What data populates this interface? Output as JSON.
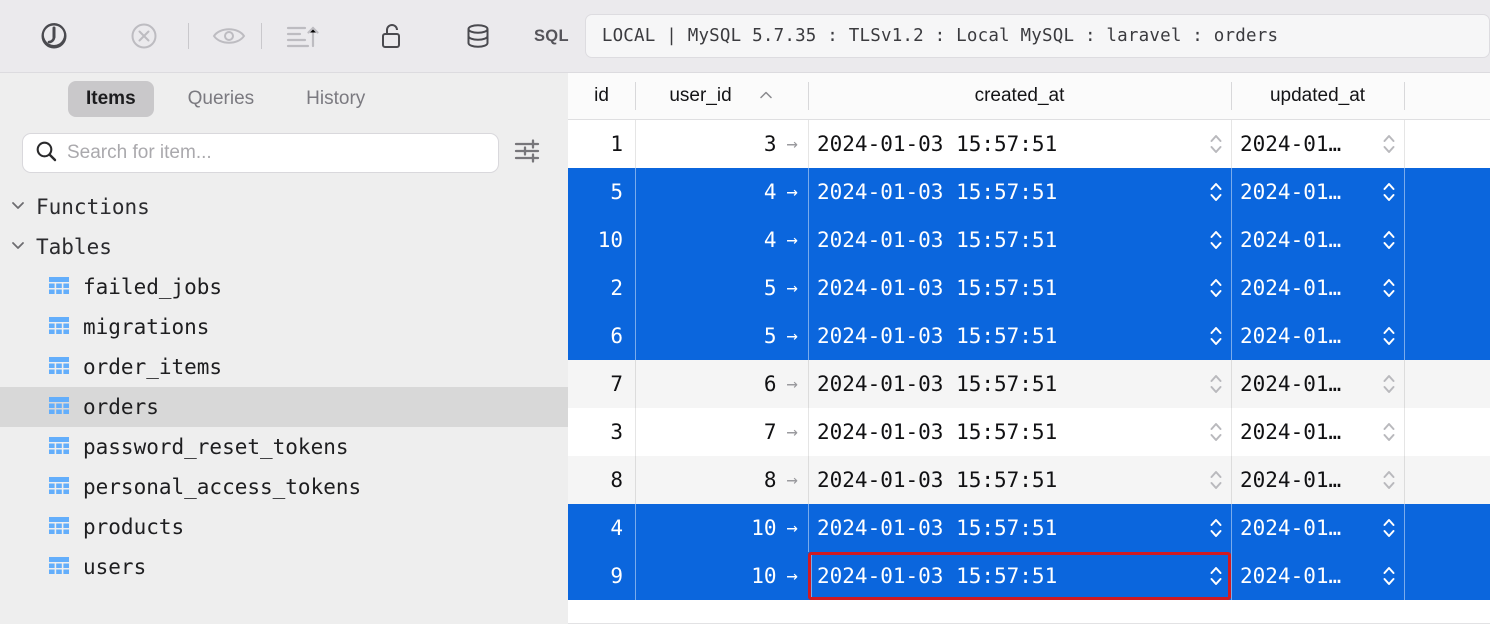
{
  "toolbar": {
    "buttons": [
      {
        "name": "connect-plug-icon",
        "title": "Connect"
      },
      {
        "name": "disconnect-close-icon",
        "title": "Disconnect"
      },
      {
        "name": "eye-icon",
        "title": "Preview"
      },
      {
        "name": "sort-ascending-icon",
        "title": "Sort"
      },
      {
        "name": "unlock-icon",
        "title": "Read-only lock"
      },
      {
        "name": "database-icon",
        "title": "Database"
      }
    ],
    "sql_label": "SQL",
    "connection": "LOCAL | MySQL 5.7.35 : TLSv1.2 : Local MySQL : laravel : orders"
  },
  "sidebar": {
    "tabs": [
      {
        "label": "Items",
        "active": true
      },
      {
        "label": "Queries",
        "active": false
      },
      {
        "label": "History",
        "active": false
      }
    ],
    "search": {
      "value": "",
      "placeholder": "Search for item..."
    },
    "filter_icon": "sliders-icon",
    "groups": [
      {
        "label": "Functions",
        "expanded": true,
        "items": []
      },
      {
        "label": "Tables",
        "expanded": true,
        "items": [
          {
            "label": "failed_jobs",
            "selected": false
          },
          {
            "label": "migrations",
            "selected": false
          },
          {
            "label": "order_items",
            "selected": false
          },
          {
            "label": "orders",
            "selected": true
          },
          {
            "label": "password_reset_tokens",
            "selected": false
          },
          {
            "label": "personal_access_tokens",
            "selected": false
          },
          {
            "label": "products",
            "selected": false
          },
          {
            "label": "users",
            "selected": false
          }
        ]
      }
    ]
  },
  "grid": {
    "columns": [
      {
        "key": "id",
        "label": "id",
        "sorted": false
      },
      {
        "key": "user_id",
        "label": "user_id",
        "sorted": true,
        "sort_dir": "asc",
        "sort_glyph": "^"
      },
      {
        "key": "created_at",
        "label": "created_at",
        "sorted": false
      },
      {
        "key": "updated_at",
        "label": "updated_at",
        "sorted": false
      }
    ],
    "fk_glyph": "→",
    "rows": [
      {
        "id": "1",
        "user_id": "3",
        "created_at": "2024-01-03 15:57:51",
        "updated_at": "2024-01…",
        "selected": false,
        "focused_cell": null
      },
      {
        "id": "5",
        "user_id": "4",
        "created_at": "2024-01-03 15:57:51",
        "updated_at": "2024-01…",
        "selected": true,
        "focused_cell": null
      },
      {
        "id": "10",
        "user_id": "4",
        "created_at": "2024-01-03 15:57:51",
        "updated_at": "2024-01…",
        "selected": true,
        "focused_cell": null
      },
      {
        "id": "2",
        "user_id": "5",
        "created_at": "2024-01-03 15:57:51",
        "updated_at": "2024-01…",
        "selected": true,
        "focused_cell": null
      },
      {
        "id": "6",
        "user_id": "5",
        "created_at": "2024-01-03 15:57:51",
        "updated_at": "2024-01…",
        "selected": true,
        "focused_cell": null
      },
      {
        "id": "7",
        "user_id": "6",
        "created_at": "2024-01-03 15:57:51",
        "updated_at": "2024-01…",
        "selected": false,
        "focused_cell": null
      },
      {
        "id": "3",
        "user_id": "7",
        "created_at": "2024-01-03 15:57:51",
        "updated_at": "2024-01…",
        "selected": false,
        "focused_cell": null
      },
      {
        "id": "8",
        "user_id": "8",
        "created_at": "2024-01-03 15:57:51",
        "updated_at": "2024-01…",
        "selected": false,
        "focused_cell": null
      },
      {
        "id": "4",
        "user_id": "10",
        "created_at": "2024-01-03 15:57:51",
        "updated_at": "2024-01…",
        "selected": true,
        "focused_cell": null
      },
      {
        "id": "9",
        "user_id": "10",
        "created_at": "2024-01-03 15:57:51",
        "updated_at": "2024-01…",
        "selected": true,
        "focused_cell": "created_at"
      }
    ]
  },
  "colors": {
    "selection_blue": "#0b66dd",
    "focus_red": "#d01a22",
    "toolbar_bg": "#ebeaed",
    "sidebar_bg": "#eeeeee",
    "row_alt": "#f5f5f5",
    "table_icon_blue": "#5aa9f8"
  }
}
